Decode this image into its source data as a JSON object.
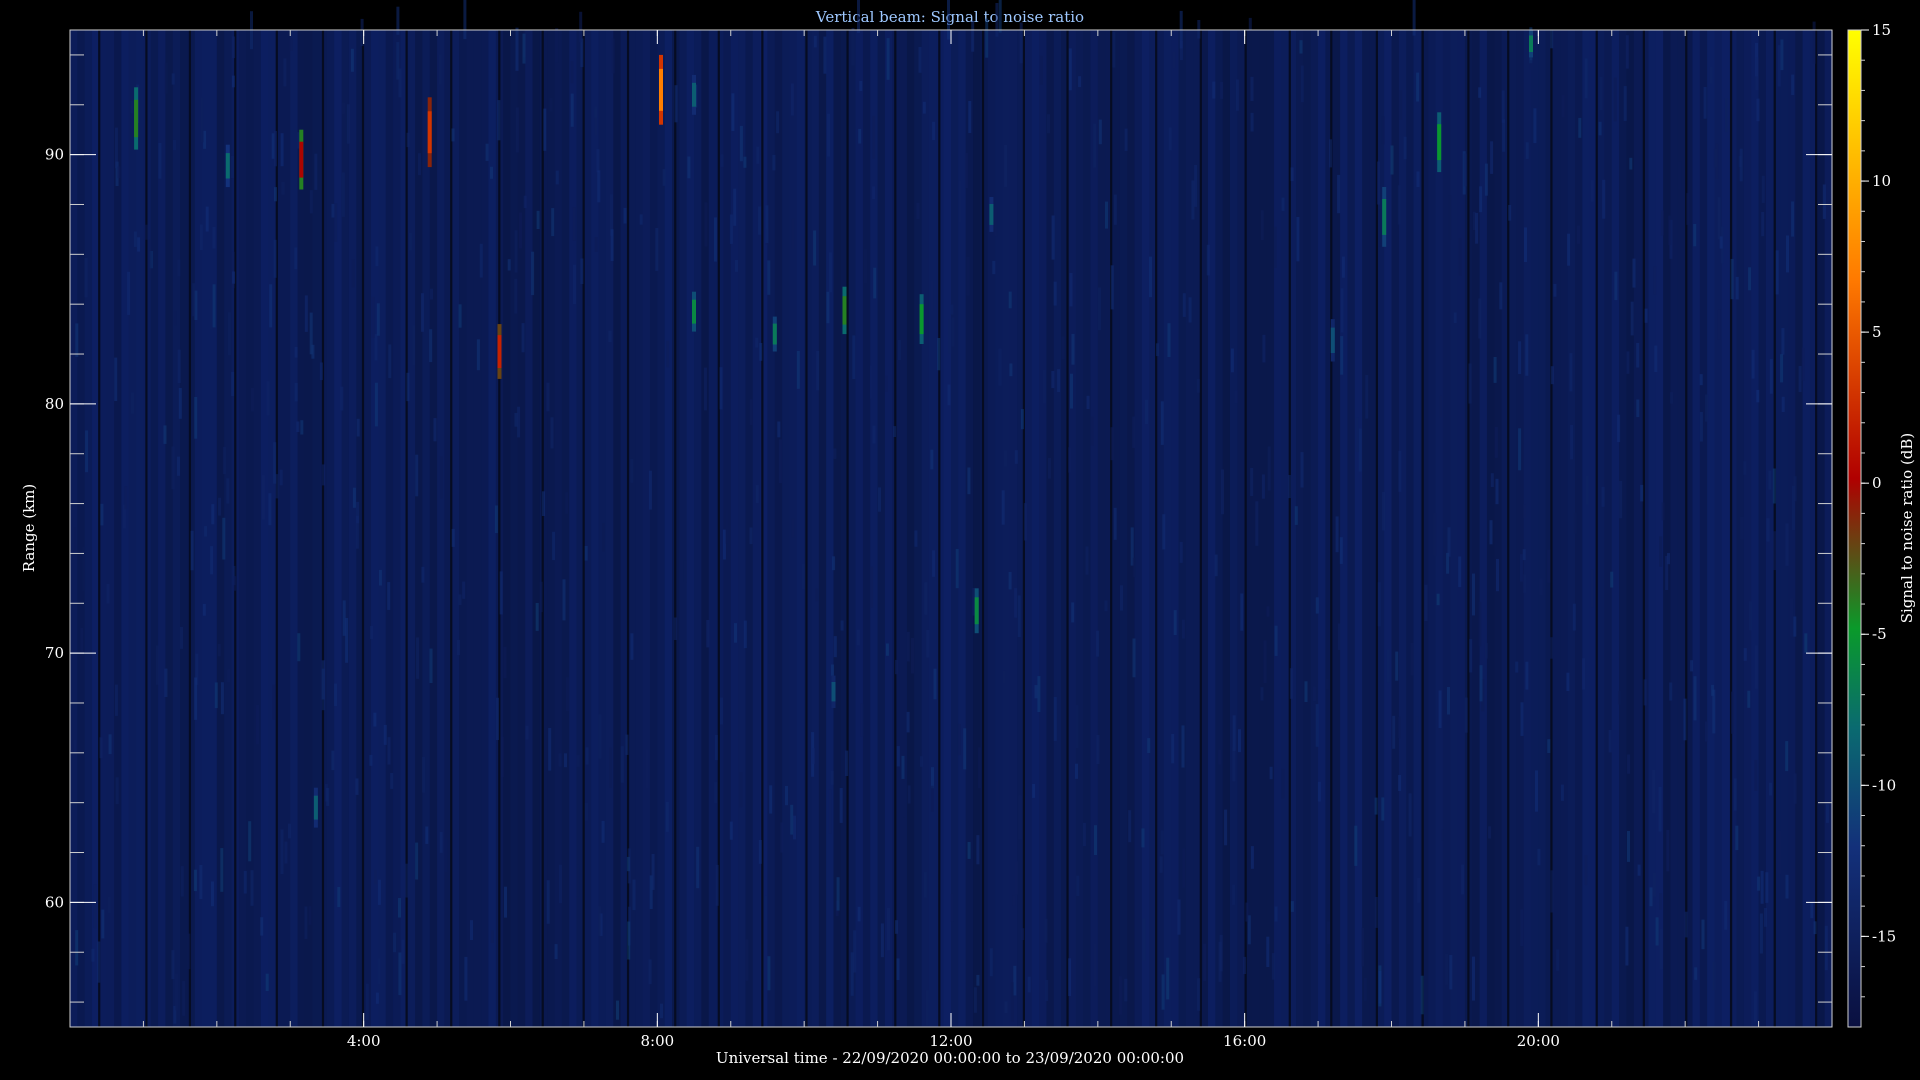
{
  "chart_data": {
    "type": "heatmap",
    "title": "Vertical beam: Signal to noise ratio",
    "xlabel": "Universal time - 22/09/2020 00:00:00 to 23/09/2020 00:00:00",
    "ylabel": "Range (km)",
    "xlim_hours": [
      0,
      24
    ],
    "ylim_km": [
      55,
      95
    ],
    "x_ticks": [
      {
        "hours": 4,
        "label": "4:00"
      },
      {
        "hours": 8,
        "label": "8:00"
      },
      {
        "hours": 12,
        "label": "12:00"
      },
      {
        "hours": 16,
        "label": "16:00"
      },
      {
        "hours": 20,
        "label": "20:00"
      }
    ],
    "y_ticks": [
      {
        "km": 60,
        "label": "60"
      },
      {
        "km": 70,
        "label": "70"
      },
      {
        "km": 80,
        "label": "80"
      },
      {
        "km": 90,
        "label": "90"
      }
    ],
    "colorbar": {
      "label": "Signal to noise ratio (dB)",
      "range_db": [
        -18,
        15
      ],
      "ticks": [
        {
          "db": -15,
          "label": "-15"
        },
        {
          "db": -10,
          "label": "-10"
        },
        {
          "db": -5,
          "label": "-5"
        },
        {
          "db": 0,
          "label": "0"
        },
        {
          "db": 5,
          "label": "5"
        },
        {
          "db": 10,
          "label": "10"
        },
        {
          "db": 15,
          "label": "15"
        }
      ],
      "colors": [
        "#0a1040",
        "#13307a",
        "#0a6a70",
        "#0a9a2a",
        "#b00000",
        "#ff7a00",
        "#ffff00"
      ]
    },
    "background_snr_db": -15,
    "echoes": [
      {
        "t_hours": 0.9,
        "km_low": 90.2,
        "km_high": 92.7,
        "snr_db": -4
      },
      {
        "t_hours": 2.15,
        "km_low": 88.7,
        "km_high": 90.4,
        "snr_db": -8
      },
      {
        "t_hours": 3.15,
        "km_low": 88.6,
        "km_high": 91.0,
        "snr_db": 0
      },
      {
        "t_hours": 3.35,
        "km_low": 63.0,
        "km_high": 64.6,
        "snr_db": -9
      },
      {
        "t_hours": 4.9,
        "km_low": 89.5,
        "km_high": 92.3,
        "snr_db": 3
      },
      {
        "t_hours": 5.85,
        "km_low": 81.0,
        "km_high": 83.2,
        "snr_db": 2
      },
      {
        "t_hours": 8.05,
        "km_low": 91.2,
        "km_high": 94.0,
        "snr_db": 7
      },
      {
        "t_hours": 8.5,
        "km_low": 91.6,
        "km_high": 93.2,
        "snr_db": -9
      },
      {
        "t_hours": 8.5,
        "km_low": 82.9,
        "km_high": 84.5,
        "snr_db": -6
      },
      {
        "t_hours": 9.6,
        "km_low": 82.1,
        "km_high": 83.5,
        "snr_db": -7
      },
      {
        "t_hours": 10.55,
        "km_low": 82.8,
        "km_high": 84.7,
        "snr_db": -4
      },
      {
        "t_hours": 10.4,
        "km_low": 67.8,
        "km_high": 69.1,
        "snr_db": -10
      },
      {
        "t_hours": 11.6,
        "km_low": 82.4,
        "km_high": 84.4,
        "snr_db": -5
      },
      {
        "t_hours": 12.35,
        "km_low": 70.8,
        "km_high": 72.6,
        "snr_db": -6
      },
      {
        "t_hours": 12.55,
        "km_low": 86.9,
        "km_high": 88.3,
        "snr_db": -9
      },
      {
        "t_hours": 17.9,
        "km_low": 86.3,
        "km_high": 88.7,
        "snr_db": -7
      },
      {
        "t_hours": 17.2,
        "km_low": 81.7,
        "km_high": 83.4,
        "snr_db": -10
      },
      {
        "t_hours": 18.65,
        "km_low": 89.3,
        "km_high": 91.7,
        "snr_db": -5
      },
      {
        "t_hours": 19.9,
        "km_low": 93.9,
        "km_high": 95.0,
        "snr_db": -7
      }
    ]
  }
}
